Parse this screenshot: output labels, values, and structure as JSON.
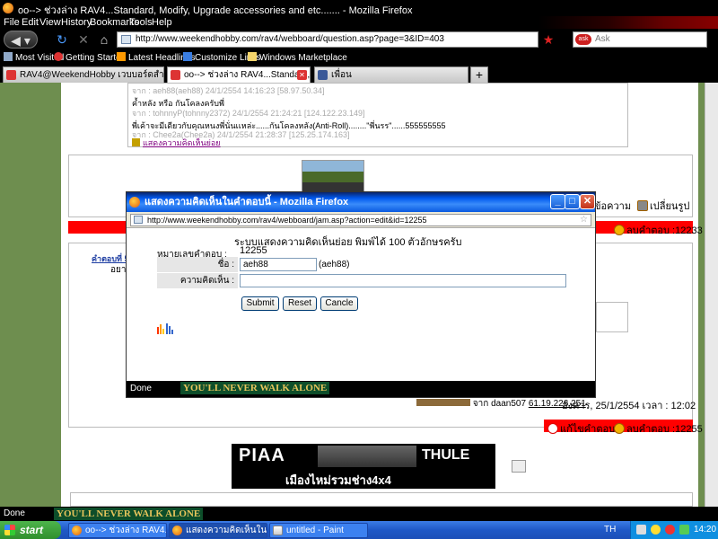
{
  "window": {
    "title": "oo--> ช่วงล่าง RAV4...Standard, Modify, Upgrade accessories and etc....... - Mozilla Firefox"
  },
  "menu": [
    "File",
    "Edit",
    "View",
    "History",
    "Bookmarks",
    "Tools",
    "Help"
  ],
  "nav": {
    "url": "http://www.weekendhobby.com/rav4/webboard/question.asp?page=3&ID=403",
    "search_placeholder": "Ask"
  },
  "bookmarks": [
    "Most Visited",
    "Getting Started",
    "Latest Headlines",
    "Customize Links",
    "Windows Marketplace"
  ],
  "tabs": [
    {
      "label": "RAV4@WeekendHobby เวบบอร์ดสำหรับ..."
    },
    {
      "label": "oo--> ช่วงล่าง RAV4...Standard, M..."
    },
    {
      "label": "เพื่อน"
    }
  ],
  "page": {
    "comments": [
      {
        "text": "จาก : aeh88(aeh88) 24/1/2554 14:16:23 [58.97.50.34]",
        "meta": true
      },
      {
        "text": "ค้ำหลัง หรือ กันโคลงครับพี่",
        "meta": false
      },
      {
        "text": "จาก : tohnnyP(tohnny2372) 24/1/2554 21:24:21 [124.122.23.149]",
        "meta": true
      },
      {
        "text": "พี่เค้าจะมีเดียวกับคุณหนงพี่นั่นเเหล่ะ......กันโคลงหลัง(Anti-Roll)........\"พี่นรร\"......555555555",
        "meta": false
      },
      {
        "text": "จาก : Chee2a(Chee2a) 24/1/2554 21:28:37 [125.25.174.163]",
        "meta": true
      }
    ],
    "add_comment": "แสดงความคิดเห็นย่อย",
    "post_actions": {
      "reply": "ข้อความ",
      "change_img": "เปลี่ยนรูป",
      "delete": "ลบคำตอบ :12233"
    },
    "post_link": "คำตอบที่ 5",
    "post_text": "อยา",
    "author": "จาก daan507",
    "author_ip": "61.19.226.251",
    "date": "อังคาร, 25/1/2554 เวลา : 12:02",
    "bottom_actions": {
      "edit": "แก้ไขคำตอบ",
      "delete": "ลบคำตอบ :12255"
    },
    "banner": {
      "left": "PIAA",
      "right": "THULE",
      "caption": "เมืองไหม่รวมช่าง4x4"
    }
  },
  "status": {
    "main": "Done",
    "ynwa": "YOU'LL NEVER WALK ALONE"
  },
  "popup": {
    "title": "แสดงความคิดเห็นในคำตอบนี้ - Mozilla Firefox",
    "url": "http://www.weekendhobby.com/rav4/webboard/jam.asp?action=edit&id=12255",
    "heading": "ระบบแสดงความคิดเห็นย่อย พิมพ์ได้ 100 ตัวอักษรครับ",
    "answer_no_label": "หมายเลขคำตอบ :",
    "answer_no": "12255",
    "name_label": "ชื่อ :",
    "name_value": "aeh88",
    "name_suffix": "(aeh88)",
    "comment_label": "ความคิดเห็น :",
    "comment_value": "",
    "buttons": {
      "submit": "Submit",
      "reset": "Reset",
      "cancel": "Cancle"
    },
    "status": "Done"
  },
  "taskbar": {
    "start": "start",
    "items": [
      "oo--> ช่วงล่าง RAV4.....",
      "แสดงความคิดเห็นในค...",
      "untitled - Paint"
    ],
    "lang": "TH",
    "clock": "14:20"
  },
  "colors": {
    "accent_red": "#ff0000",
    "sidebar_green": "#6e8e4f",
    "ynwa_green": "#0d4e2a",
    "ynwa_gold": "#e6c45b"
  }
}
